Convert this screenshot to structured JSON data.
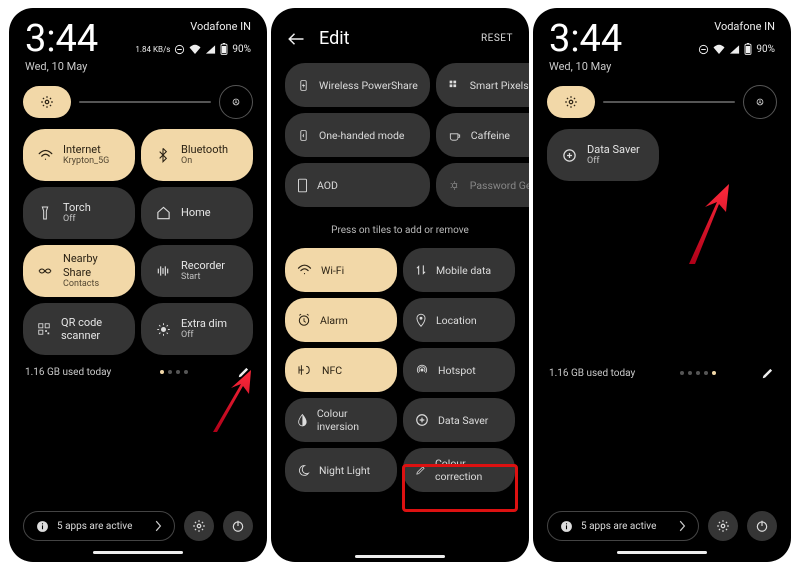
{
  "status": {
    "time": "3:44",
    "date": "Wed, 10 May",
    "carrier": "Vodafone IN",
    "speed": "1.84 KB/s",
    "battery": "90%"
  },
  "brightness": {
    "gear_icon": "gear",
    "auto_icon": "auto"
  },
  "tiles1": {
    "internet": {
      "title": "Internet",
      "sub": "Krypton_5G"
    },
    "bluetooth": {
      "title": "Bluetooth",
      "sub": "On"
    },
    "torch": {
      "title": "Torch",
      "sub": "Off"
    },
    "home": {
      "title": "Home",
      "sub": ""
    },
    "nearby": {
      "title": "Nearby Share",
      "sub": "Contacts"
    },
    "recorder": {
      "title": "Recorder",
      "sub": "Start"
    },
    "qr": {
      "title": "QR code scanner",
      "sub": ""
    },
    "extradim": {
      "title": "Extra dim",
      "sub": "Off"
    }
  },
  "data_usage": "1.16 GB used today",
  "apps_active": "5 apps are active",
  "edit": {
    "title": "Edit",
    "reset": "RESET",
    "hint": "Press on tiles to add or remove",
    "top": {
      "wireless_powershare": "Wireless PowerShare",
      "smart_pixels": "Smart Pixels",
      "one_handed": "One-handed mode",
      "caffeine": "Caffeine",
      "aod": "AOD",
      "password_gen": "Password Generator"
    },
    "bottom": {
      "wifi": "Wi-Fi",
      "mobile_data": "Mobile data",
      "alarm": "Alarm",
      "location": "Location",
      "nfc": "NFC",
      "hotspot": "Hotspot",
      "colour_inversion": "Colour inversion",
      "data_saver": "Data Saver",
      "night_light": "Night Light",
      "colour_correction": "Colour correction"
    }
  },
  "tiles3": {
    "data_saver": {
      "title": "Data Saver",
      "sub": "Off"
    }
  }
}
